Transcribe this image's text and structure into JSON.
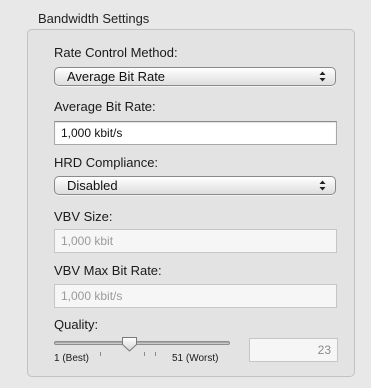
{
  "group": {
    "title": "Bandwidth Settings"
  },
  "rate_control": {
    "label": "Rate Control Method:",
    "selected": "Average Bit Rate"
  },
  "average_bit_rate": {
    "label": "Average Bit Rate:",
    "value": "1,000 kbit/s"
  },
  "hrd_compliance": {
    "label": "HRD Compliance:",
    "selected": "Disabled"
  },
  "vbv_size": {
    "label": "VBV Size:",
    "value": "1,000 kbit"
  },
  "vbv_max_bit_rate": {
    "label": "VBV Max Bit Rate:",
    "value": "1,000 kbit/s"
  },
  "quality": {
    "label": "Quality:",
    "min_label": "1 (Best)",
    "max_label": "51 (Worst)",
    "value": "23",
    "slider_min": 1,
    "slider_max": 51,
    "slider_value": 23
  },
  "icons": {
    "popup_arrows": "up-down-chevron-icon",
    "slider_knob": "slider-knob"
  }
}
